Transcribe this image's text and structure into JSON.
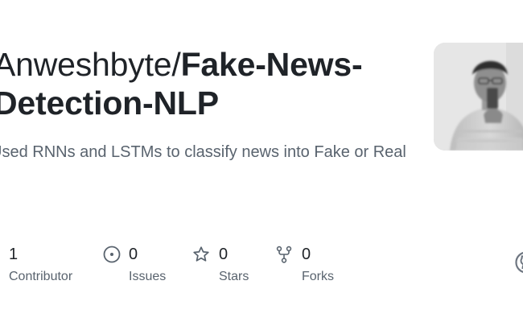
{
  "repo": {
    "owner": "Anweshbyte/",
    "name": "Fake-News-Detection-NLP",
    "description": "Used RNNs and LSTMs to classify news into Fake or Real"
  },
  "stats": {
    "contributors": {
      "value": "1",
      "label": "Contributor",
      "icon": "people-icon"
    },
    "issues": {
      "value": "0",
      "label": "Issues",
      "icon": "issue-opened-icon"
    },
    "stars": {
      "value": "0",
      "label": "Stars",
      "icon": "star-icon"
    },
    "forks": {
      "value": "0",
      "label": "Forks",
      "icon": "repo-forked-icon"
    }
  },
  "colors": {
    "title": "#1f2328",
    "muted": "#59636e",
    "logo": "#6e7681"
  }
}
